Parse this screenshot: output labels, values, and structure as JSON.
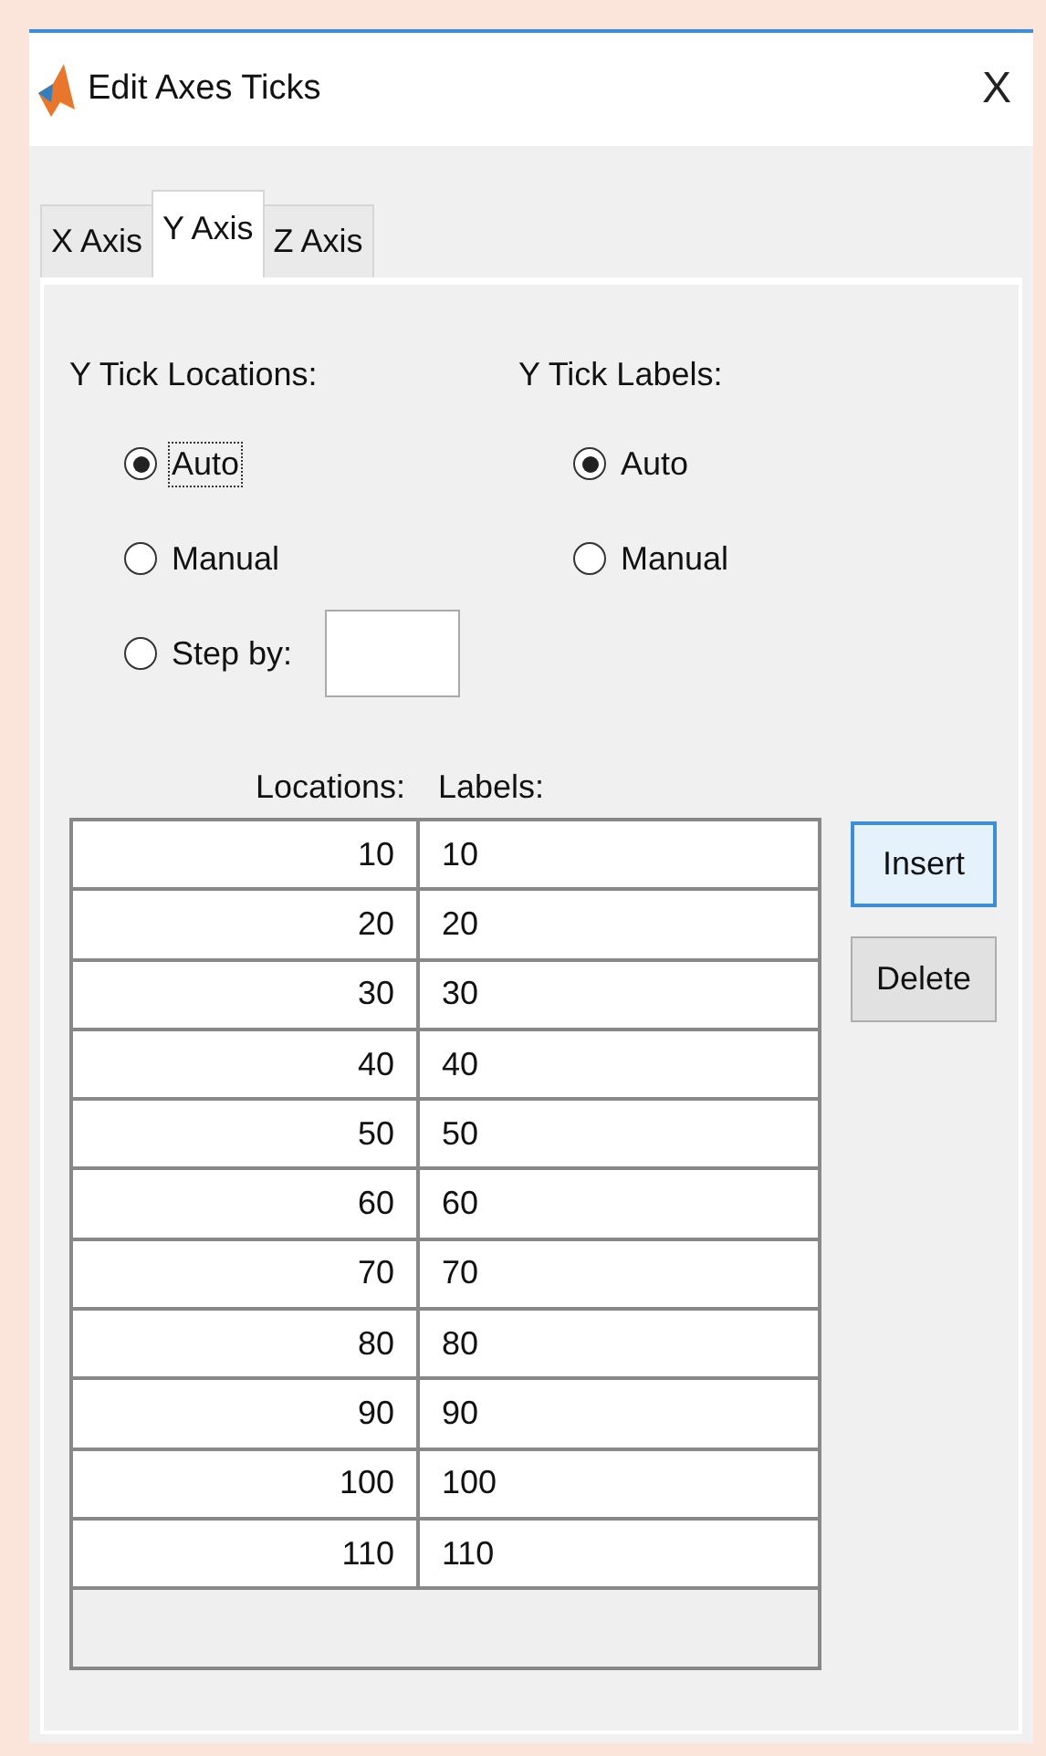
{
  "window": {
    "title": "Edit Axes Ticks",
    "close": "X"
  },
  "tabs": [
    {
      "label": "X Axis",
      "selected": false
    },
    {
      "label": "Y Axis",
      "selected": true
    },
    {
      "label": "Z Axis",
      "selected": false
    }
  ],
  "locations": {
    "heading": "Y Tick Locations:",
    "options": [
      {
        "label": "Auto",
        "selected": true,
        "focused": true
      },
      {
        "label": "Manual",
        "selected": false,
        "focused": false
      },
      {
        "label": "Step by:",
        "selected": false,
        "focused": false,
        "kind": "field"
      }
    ]
  },
  "labels": {
    "heading": "Y Tick Labels:",
    "options": [
      {
        "label": "Auto",
        "selected": true,
        "focused": false
      },
      {
        "label": "Manual",
        "selected": false,
        "focused": false
      }
    ]
  },
  "table": {
    "columns": [
      "Locations:",
      "Labels:"
    ],
    "rows": [
      [
        "10",
        "10"
      ],
      [
        "20",
        "20"
      ],
      [
        "30",
        "30"
      ],
      [
        "40",
        "40"
      ],
      [
        "50",
        "50"
      ],
      [
        "60",
        "60"
      ],
      [
        "70",
        "70"
      ],
      [
        "80",
        "80"
      ],
      [
        "90",
        "90"
      ],
      [
        "100",
        "100"
      ],
      [
        "110",
        "110"
      ]
    ]
  },
  "buttons": [
    "Insert",
    "Delete"
  ]
}
